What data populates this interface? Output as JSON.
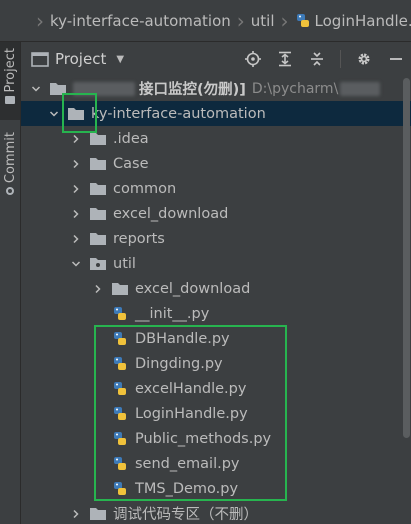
{
  "breadcrumb": {
    "items": [
      "ky-interface-automation",
      "util",
      "LoginHandle.py"
    ]
  },
  "side_strip": {
    "project_label": "Project",
    "commit_label": "Commit"
  },
  "panel": {
    "title": "Project",
    "tools": [
      "locate-icon",
      "expand-all-icon",
      "collapse-all-icon",
      "settings-gear-icon",
      "hide-minus-icon"
    ]
  },
  "tree": {
    "root": {
      "label": "接口监控(勿删)]",
      "path_hint": "D:\\pycharm\\"
    },
    "project": "ky-interface-automation",
    "folders": [
      ".idea",
      "Case",
      "common",
      "excel_download",
      "reports",
      "util"
    ],
    "util_children": {
      "subfolder": "excel_download",
      "init_file": "__init__.py",
      "files": [
        "DBHandle.py",
        "Dingding.py",
        "excelHandle.py",
        "LoginHandle.py",
        "Public_methods.py",
        "send_email.py",
        "TMS_Demo.py"
      ]
    },
    "bottom_partial": "调试代码专区（不删）"
  },
  "colors": {
    "background": "#3c3f41",
    "selection": "#0d293e",
    "highlight_box": "#27b44f",
    "folder": "#aeb3b8",
    "python_blue": "#3d7ab8",
    "python_yellow": "#f0c23b"
  }
}
